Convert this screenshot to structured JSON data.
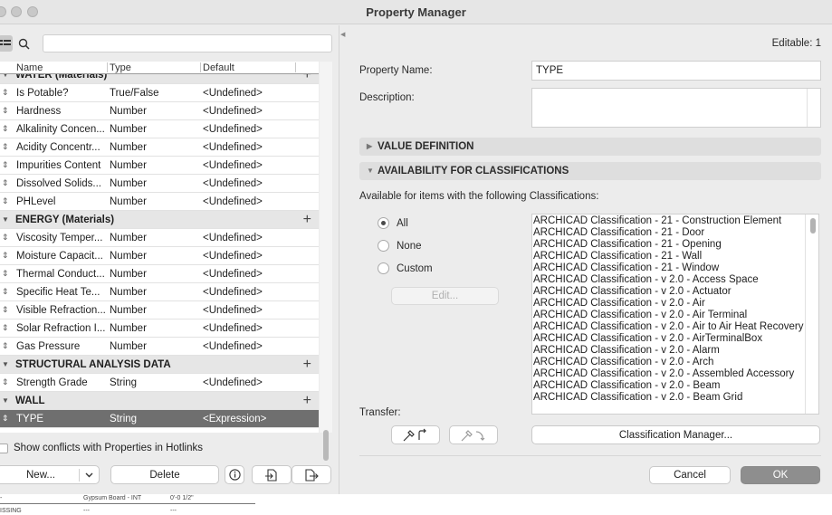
{
  "window": {
    "title": "Property Manager"
  },
  "left": {
    "columns": {
      "name": "Name",
      "type": "Type",
      "default": "Default"
    },
    "rows": [
      {
        "kind": "group",
        "name": "WATER (Materials)",
        "top": true
      },
      {
        "kind": "item",
        "name": "Is Potable?",
        "type": "True/False",
        "default": "<Undefined>"
      },
      {
        "kind": "item",
        "name": "Hardness",
        "type": "Number",
        "default": "<Undefined>"
      },
      {
        "kind": "item",
        "name": "Alkalinity Concen...",
        "type": "Number",
        "default": "<Undefined>"
      },
      {
        "kind": "item",
        "name": "Acidity Concentr...",
        "type": "Number",
        "default": "<Undefined>"
      },
      {
        "kind": "item",
        "name": "Impurities Content",
        "type": "Number",
        "default": "<Undefined>"
      },
      {
        "kind": "item",
        "name": "Dissolved Solids...",
        "type": "Number",
        "default": "<Undefined>"
      },
      {
        "kind": "item",
        "name": "PHLevel",
        "type": "Number",
        "default": "<Undefined>"
      },
      {
        "kind": "group",
        "name": "ENERGY (Materials)"
      },
      {
        "kind": "item",
        "name": "Viscosity Temper...",
        "type": "Number",
        "default": "<Undefined>"
      },
      {
        "kind": "item",
        "name": "Moisture Capacit...",
        "type": "Number",
        "default": "<Undefined>"
      },
      {
        "kind": "item",
        "name": "Thermal Conduct...",
        "type": "Number",
        "default": "<Undefined>"
      },
      {
        "kind": "item",
        "name": "Specific Heat Te...",
        "type": "Number",
        "default": "<Undefined>"
      },
      {
        "kind": "item",
        "name": "Visible Refraction...",
        "type": "Number",
        "default": "<Undefined>"
      },
      {
        "kind": "item",
        "name": "Solar Refraction I...",
        "type": "Number",
        "default": "<Undefined>"
      },
      {
        "kind": "item",
        "name": "Gas Pressure",
        "type": "Number",
        "default": "<Undefined>"
      },
      {
        "kind": "group",
        "name": "STRUCTURAL ANALYSIS DATA"
      },
      {
        "kind": "item",
        "name": "Strength Grade",
        "type": "String",
        "default": "<Undefined>"
      },
      {
        "kind": "group",
        "name": "WALL"
      },
      {
        "kind": "item",
        "name": "TYPE",
        "type": "String",
        "default": "<Expression>",
        "selected": true
      }
    ],
    "show_conflicts_label": "Show conflicts with Properties in Hotlinks",
    "new_button": "New...",
    "delete_button": "Delete"
  },
  "right": {
    "editable": "Editable: 1",
    "property_name_label": "Property Name:",
    "property_name_value": "TYPE",
    "description_label": "Description:",
    "value_definition": "VALUE DEFINITION",
    "availability": "AVAILABILITY FOR CLASSIFICATIONS",
    "available_text": "Available for items with the following Classifications:",
    "radio_all": "All",
    "radio_none": "None",
    "radio_custom": "Custom",
    "edit_button": "Edit...",
    "classifications": [
      "ARCHICAD Classification - 21 - Construction Element",
      "ARCHICAD Classification - 21 - Door",
      "ARCHICAD Classification - 21 - Opening",
      "ARCHICAD Classification - 21 - Wall",
      "ARCHICAD Classification - 21 - Window",
      "ARCHICAD Classification - v 2.0 - Access Space",
      "ARCHICAD Classification - v 2.0 - Actuator",
      "ARCHICAD Classification - v 2.0 - Air",
      "ARCHICAD Classification - v 2.0 - Air Terminal",
      "ARCHICAD Classification - v 2.0 - Air to Air Heat Recovery",
      "ARCHICAD Classification - v 2.0 - AirTerminalBox",
      "ARCHICAD Classification - v 2.0 - Alarm",
      "ARCHICAD Classification - v 2.0 - Arch",
      "ARCHICAD Classification - v 2.0 - Assembled Accessory",
      "ARCHICAD Classification - v 2.0 - Beam",
      "ARCHICAD Classification - v 2.0 - Beam Grid"
    ],
    "transfer_label": "Transfer:",
    "classification_manager_button": "Classification Manager...",
    "cancel_button": "Cancel",
    "ok_button": "OK"
  },
  "background": {
    "row1": [
      "-",
      "Gypsum Board - INT",
      "0'-0 1/2\""
    ],
    "row2": [
      "ISSING",
      "---",
      "---"
    ]
  }
}
